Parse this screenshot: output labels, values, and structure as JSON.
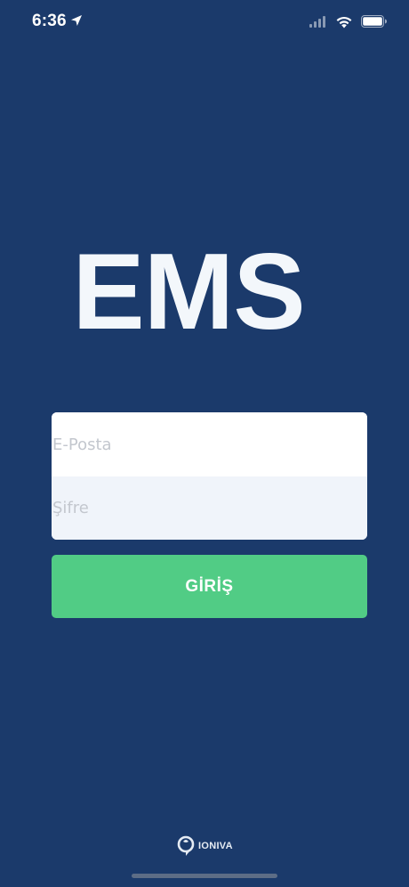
{
  "status_bar": {
    "time": "6:36",
    "icons": [
      "location-arrow-icon",
      "signal-icon",
      "wifi-icon",
      "battery-icon"
    ]
  },
  "app": {
    "title": "EMS"
  },
  "login": {
    "email_placeholder": "E-Posta",
    "email_value": "",
    "password_placeholder": "Şifre",
    "password_value": "",
    "submit_label": "GİRİŞ"
  },
  "footer": {
    "brand": "IONIVA"
  },
  "colors": {
    "background": "#1b3a6b",
    "button": "#51cc85",
    "title": "#f3f7fb",
    "placeholder": "#c3c7ce"
  }
}
